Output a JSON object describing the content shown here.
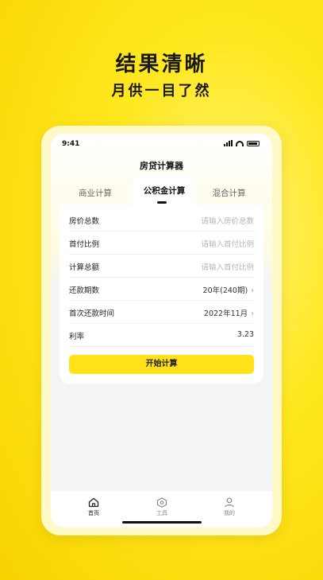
{
  "promo": {
    "title": "结果清晰",
    "subtitle": "月供一目了然"
  },
  "status_bar": {
    "time": "9:41"
  },
  "app": {
    "title": "房贷计算器"
  },
  "tabs": [
    {
      "label": "商业计算",
      "active": false
    },
    {
      "label": "公积金计算",
      "active": true
    },
    {
      "label": "混合计算",
      "active": false
    }
  ],
  "form": {
    "rows": [
      {
        "label": "房价总数",
        "placeholder": "请输入房价总数"
      },
      {
        "label": "首付比例",
        "placeholder": "请输入首付比例"
      },
      {
        "label": "计算总额",
        "placeholder": "请输入首付比例"
      },
      {
        "label": "还款期数",
        "value": "20年(240期)"
      },
      {
        "label": "首次还款时间",
        "value": "2022年11月"
      },
      {
        "label": "利率",
        "value": "3.23"
      }
    ],
    "chevron": "›",
    "submit_label": "开始计算"
  },
  "bottom_nav": [
    {
      "label": "首页",
      "icon": "home-icon",
      "active": true
    },
    {
      "label": "工具",
      "icon": "tools-icon",
      "active": false
    },
    {
      "label": "我的",
      "icon": "user-icon",
      "active": false
    }
  ],
  "colors": {
    "accent": "#ffe21a",
    "background": "#ffe81f"
  }
}
